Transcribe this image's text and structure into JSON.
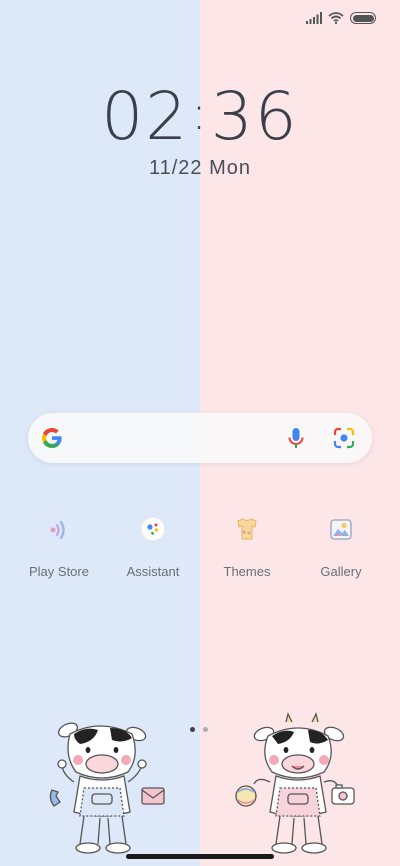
{
  "wallpaper": {
    "left_color": "#dde9f9",
    "right_color": "#fce6e7"
  },
  "status_bar": {
    "icons": [
      "signal-icon",
      "wifi-icon",
      "battery-icon"
    ],
    "battery_level": 1.0
  },
  "clock": {
    "hours": "02",
    "separator": ":",
    "minutes": "36"
  },
  "date": {
    "text": "11/22 Mon"
  },
  "search_bar": {
    "icons": [
      "google-logo-icon",
      "microphone-icon",
      "google-lens-icon"
    ]
  },
  "apps": [
    {
      "label": "Play Store",
      "icon": "play-store-icon"
    },
    {
      "label": "Assistant",
      "icon": "assistant-icon"
    },
    {
      "label": "Themes",
      "icon": "themes-icon"
    },
    {
      "label": "Gallery",
      "icon": "gallery-icon"
    }
  ],
  "page_indicator": {
    "pages": 2,
    "current": 1,
    "active_color": "#3b3f4a",
    "inactive_color": "#a9adb5"
  }
}
